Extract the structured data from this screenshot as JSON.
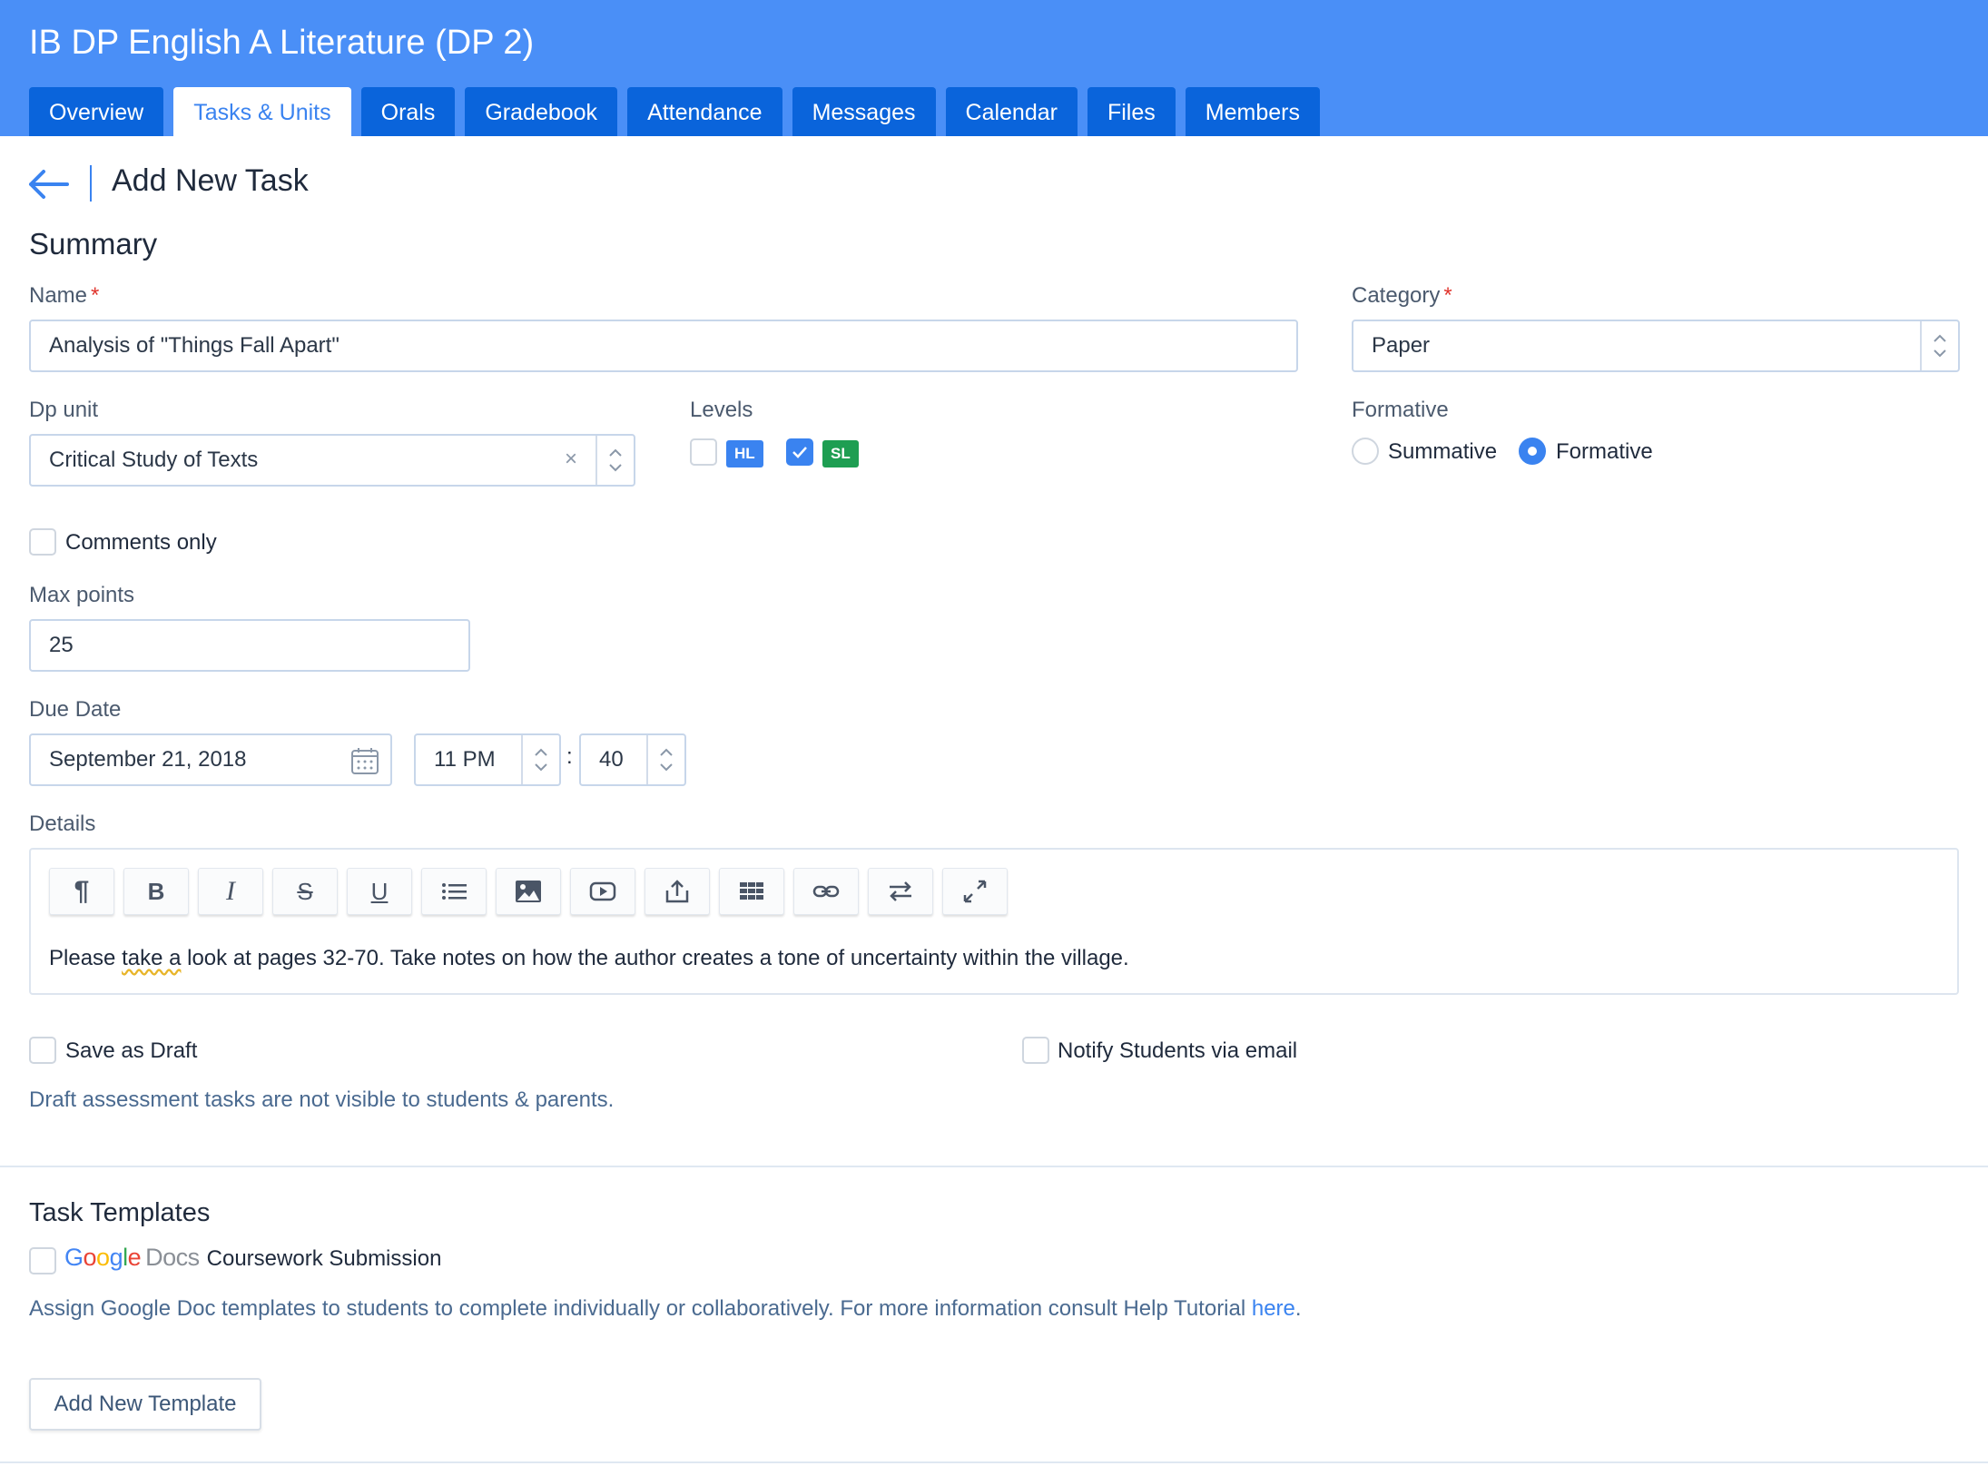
{
  "header": {
    "course_title": "IB DP English A Literature (DP 2)",
    "tabs": [
      "Overview",
      "Tasks & Units",
      "Orals",
      "Gradebook",
      "Attendance",
      "Messages",
      "Calendar",
      "Files",
      "Members"
    ],
    "active_tab": "Tasks & Units"
  },
  "page": {
    "title": "Add New Task"
  },
  "summary": {
    "heading": "Summary",
    "name_label": "Name",
    "name_value": "Analysis of \"Things Fall Apart\"",
    "category_label": "Category",
    "category_value": "Paper",
    "dp_unit_label": "Dp unit",
    "dp_unit_value": "Critical Study of Texts",
    "levels_label": "Levels",
    "levels": [
      {
        "code": "HL",
        "checked": false
      },
      {
        "code": "SL",
        "checked": true
      }
    ],
    "formative_label": "Formative",
    "formative_options": [
      "Summative",
      "Formative"
    ],
    "formative_selected": "Formative",
    "comments_only_label": "Comments only",
    "max_points_label": "Max points",
    "max_points_value": "25",
    "due_date_label": "Due Date",
    "due_date_value": "September 21, 2018",
    "due_hour_value": "11 PM",
    "time_separator": ":",
    "due_minute_value": "40"
  },
  "details": {
    "label": "Details",
    "toolbar": [
      "paragraph",
      "bold",
      "italic",
      "strikethrough",
      "underline",
      "list",
      "image",
      "video",
      "upload",
      "table",
      "link",
      "swap",
      "fullscreen"
    ],
    "text_before": "Please ",
    "text_marked": "take a",
    "text_after": " look at pages 32-70. Take notes on how the author creates a tone of uncertainty within the village."
  },
  "options": {
    "save_draft_label": "Save as Draft",
    "notify_label": "Notify Students via email",
    "draft_note": "Draft assessment tasks are not visible to students & parents."
  },
  "templates": {
    "heading": "Task Templates",
    "google_word": "Google",
    "docs_word": "Docs",
    "coursework_label": "Coursework Submission",
    "info_text": "Assign Google Doc templates to students to complete individually or collaboratively. For more information consult Help Tutorial ",
    "info_link": "here",
    "info_end": ".",
    "add_button": "Add New Template"
  },
  "colors": {
    "header_bg": "#4a8ff7",
    "tab_bg": "#0a64db",
    "accent": "#3a83f0",
    "badge_sl": "#1e9e52",
    "required": "#e0342c"
  }
}
